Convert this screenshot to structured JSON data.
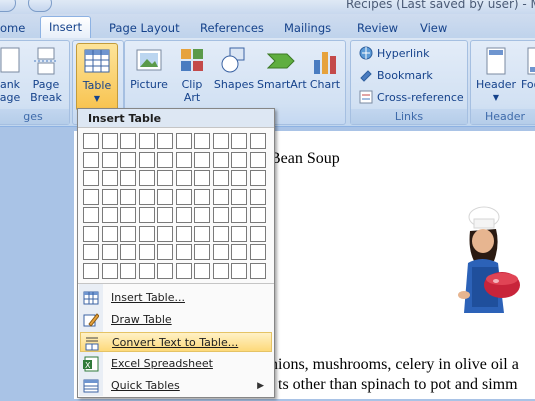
{
  "window": {
    "title": "Recipes (Last saved by user) - M"
  },
  "tabs": [
    {
      "label": "ome"
    },
    {
      "label": "Insert"
    },
    {
      "label": "Page Layout"
    },
    {
      "label": "References"
    },
    {
      "label": "Mailings"
    },
    {
      "label": "Review"
    },
    {
      "label": "View"
    }
  ],
  "ribbon": {
    "pages_group": {
      "label": "ges",
      "blank_page": [
        "ank",
        "age"
      ],
      "page_break": [
        "Page",
        "Break"
      ]
    },
    "tables_group": {
      "table": "Table"
    },
    "illustrations_group": {
      "picture": "Picture",
      "clip_art": [
        "Clip",
        "Art"
      ],
      "shapes": "Shapes",
      "smartart": "SmartArt",
      "chart": "Chart"
    },
    "links_group": {
      "label": "Links",
      "hyperlink": "Hyperlink",
      "bookmark": "Bookmark",
      "cross_reference": "Cross-reference"
    },
    "header_footer_group": {
      "label": "Header",
      "header": "Header",
      "footer": "Foo"
    }
  },
  "insert_table_menu": {
    "header": "Insert Table",
    "grid": {
      "columns": 10,
      "rows": 8
    },
    "items": [
      {
        "label": "Insert Table...",
        "icon": "table-icon"
      },
      {
        "label": "Draw Table",
        "icon": "pencil-icon"
      },
      {
        "label": "Convert Text to Table...",
        "icon": "convert-text-icon",
        "highlighted": true
      },
      {
        "label": "Excel Spreadsheet",
        "icon": "excel-icon"
      },
      {
        "label": "Quick Tables",
        "icon": "quick-tables-icon",
        "submenu": true
      }
    ]
  },
  "document": {
    "line1": "Bean Soup",
    "line2": "nions, mushrooms, celery in olive oil a",
    "line3": "ts other than spinach to pot and simm",
    "image": "chef-girl-with-heart-bowl"
  }
}
